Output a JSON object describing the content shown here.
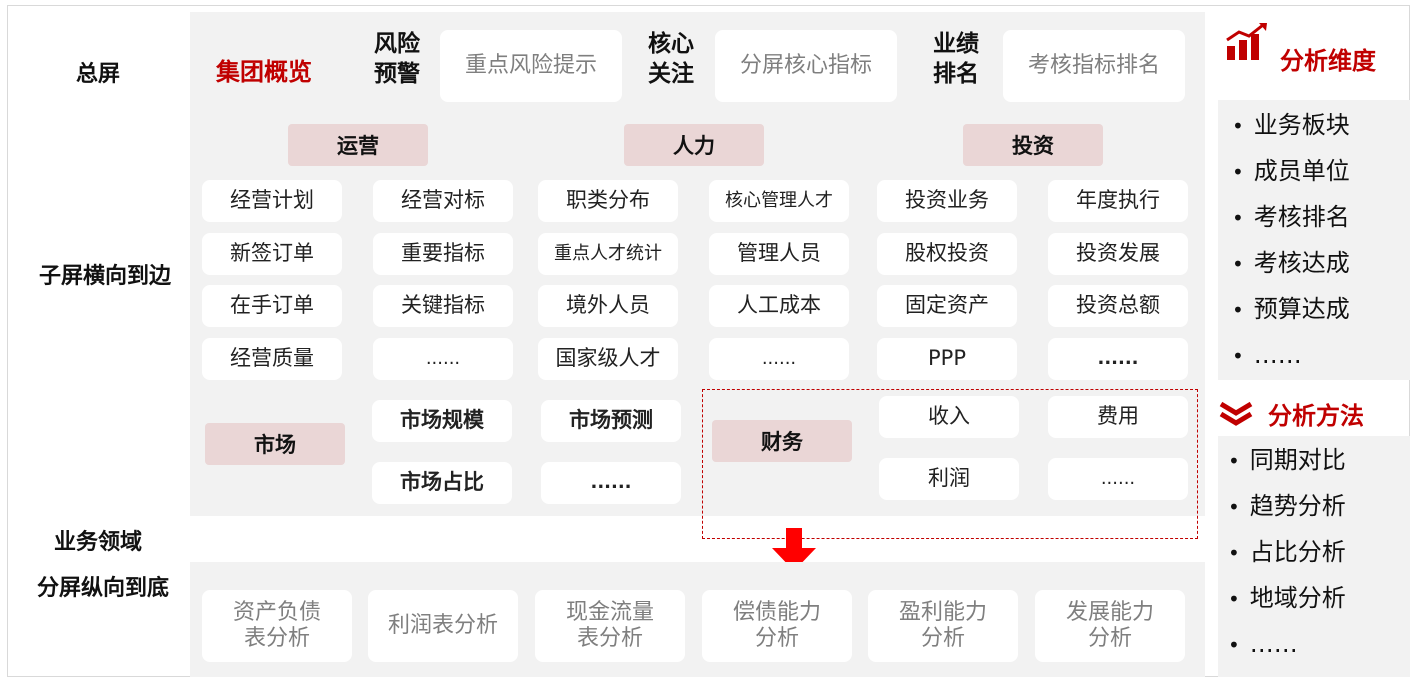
{
  "row_labels": {
    "main_screen": "总屏",
    "sub_horizontal": "子屏横向到边",
    "domain_line1": "业务领域",
    "domain_line2": "分屏纵向到底"
  },
  "header": {
    "group_overview": "集团概览",
    "risk_label_1": "风险",
    "risk_label_2": "预警",
    "risk_box": "重点风险提示",
    "core_label_1": "核心",
    "core_label_2": "关注",
    "core_box": "分屏核心指标",
    "perf_label_1": "业绩",
    "perf_label_2": "排名",
    "perf_box": "考核指标排名"
  },
  "operations": {
    "title": "运营",
    "items": [
      "经营计划",
      "经营对标",
      "新签订单",
      "重要指标",
      "在手订单",
      "关键指标",
      "经营质量",
      "......"
    ]
  },
  "hr": {
    "title": "人力",
    "items": [
      "职类分布",
      "核心管理人才",
      "重点人才统计",
      "管理人员",
      "境外人员",
      "人工成本",
      "国家级人才",
      "......"
    ]
  },
  "investment": {
    "title": "投资",
    "items": [
      "投资业务",
      "年度执行",
      "股权投资",
      "投资发展",
      "固定资产",
      "投资总额",
      "PPP",
      "......"
    ]
  },
  "market": {
    "title": "市场",
    "items": [
      "市场规模",
      "市场预测",
      "市场占比",
      "......"
    ]
  },
  "finance": {
    "title": "财务",
    "items": [
      "收入",
      "费用",
      "利润",
      "......"
    ]
  },
  "analysis": {
    "items": [
      {
        "line1": "资产负债",
        "line2": "表分析"
      },
      {
        "line1": "利润表分析",
        "line2": ""
      },
      {
        "line1": "现金流量",
        "line2": "表分析"
      },
      {
        "line1": "偿债能力",
        "line2": "分析"
      },
      {
        "line1": "盈利能力",
        "line2": "分析"
      },
      {
        "line1": "发展能力",
        "line2": "分析"
      }
    ]
  },
  "dimensions": {
    "title": "分析维度",
    "icon": "bar-chart-trend-icon",
    "items": [
      "业务板块",
      "成员单位",
      "考核排名",
      "考核达成",
      "预算达成",
      "……"
    ]
  },
  "methods": {
    "title": "分析方法",
    "icon": "double-chevron-down-icon",
    "items": [
      "同期对比",
      "趋势分析",
      "占比分析",
      "地域分析",
      "……"
    ]
  },
  "colors": {
    "accent": "#c00000",
    "panel": "#f2f2f2",
    "category": "#ead6d6",
    "arrow": "#ff0000"
  }
}
